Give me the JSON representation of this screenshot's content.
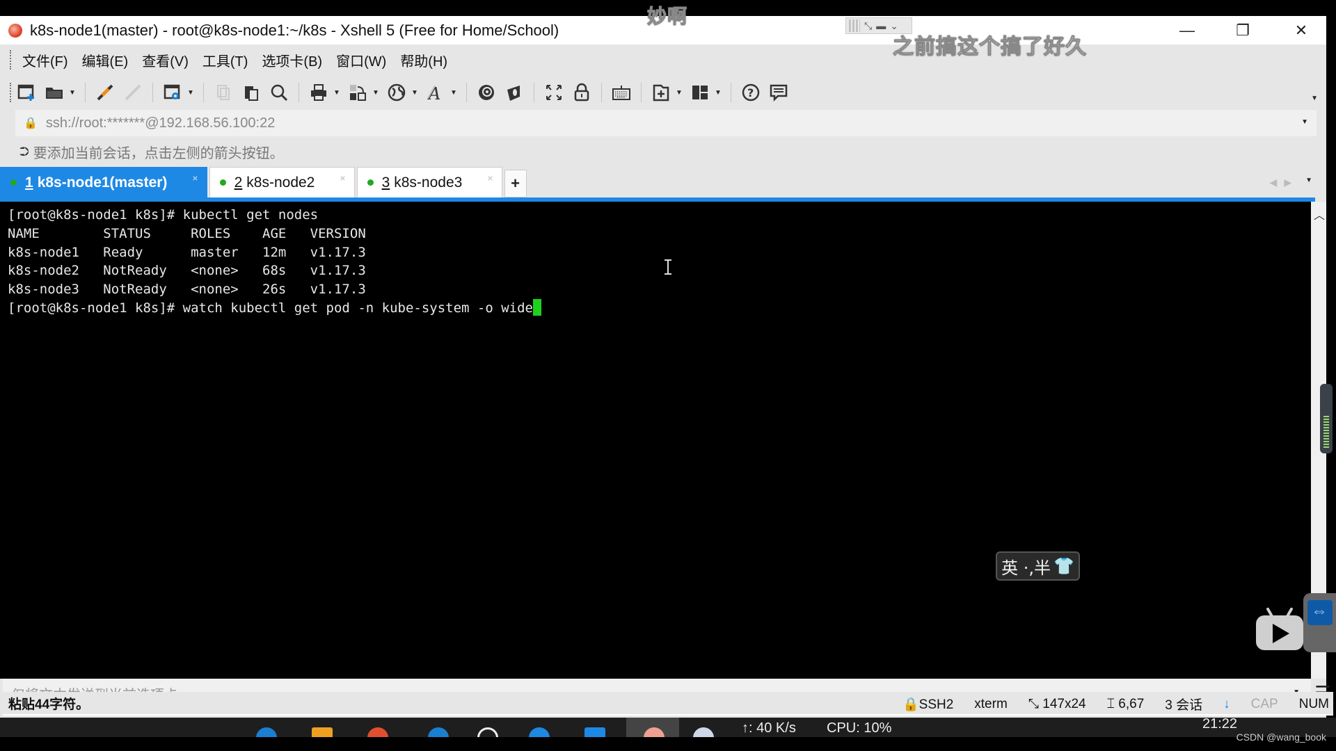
{
  "overlay": {
    "subtitle_top": "妙啊",
    "subtitle_right": "之前搞这个搞了好久"
  },
  "window": {
    "title": "k8s-node1(master) - root@k8s-node1:~/k8s - Xshell 5 (Free for Home/School)",
    "controls": {
      "minimize": "—",
      "maximize": "❐",
      "close": "✕"
    }
  },
  "menu": {
    "items": [
      {
        "label": "文件(F)"
      },
      {
        "label": "编辑(E)"
      },
      {
        "label": "查看(V)"
      },
      {
        "label": "工具(T)"
      },
      {
        "label": "选项卡(B)"
      },
      {
        "label": "窗口(W)"
      },
      {
        "label": "帮助(H)"
      }
    ]
  },
  "toolbar": {
    "buttons": [
      {
        "name": "new-session",
        "icon": "new-session-icon",
        "dropdown": false
      },
      {
        "name": "open",
        "icon": "folder-open-icon",
        "dropdown": true
      },
      {
        "name": "connect",
        "icon": "connect-icon",
        "dropdown": false
      },
      {
        "name": "disconnect",
        "icon": "disconnect-icon",
        "dropdown": false,
        "disabled": true
      },
      {
        "name": "properties",
        "icon": "properties-gear-icon",
        "dropdown": true
      },
      {
        "name": "copy",
        "icon": "copy-icon",
        "dropdown": false,
        "disabled": true
      },
      {
        "name": "paste",
        "icon": "paste-icon",
        "dropdown": false
      },
      {
        "name": "find",
        "icon": "search-icon",
        "dropdown": false
      },
      {
        "name": "print",
        "icon": "print-icon",
        "dropdown": true
      },
      {
        "name": "transfer",
        "icon": "transfer-icon",
        "dropdown": true
      },
      {
        "name": "encoding",
        "icon": "globe-icon",
        "dropdown": true
      },
      {
        "name": "font",
        "icon": "font-icon",
        "dropdown": true
      },
      {
        "name": "xftp",
        "icon": "xftp-icon",
        "dropdown": false
      },
      {
        "name": "xmanager",
        "icon": "xmanager-icon",
        "dropdown": false
      },
      {
        "name": "fullscreen",
        "icon": "fullscreen-icon",
        "dropdown": false
      },
      {
        "name": "lock",
        "icon": "lock-icon",
        "dropdown": false
      },
      {
        "name": "keyboard",
        "icon": "keyboard-icon",
        "dropdown": false
      },
      {
        "name": "new-tab",
        "icon": "add-tab-icon",
        "dropdown": true
      },
      {
        "name": "layout",
        "icon": "layout-icon",
        "dropdown": true
      },
      {
        "name": "help",
        "icon": "help-icon",
        "dropdown": false
      },
      {
        "name": "chat",
        "icon": "chat-icon",
        "dropdown": false
      }
    ]
  },
  "address": {
    "value": "ssh://root:*******@192.168.56.100:22"
  },
  "hint": {
    "text": "要添加当前会话，点击左侧的箭头按钮。"
  },
  "tabs": [
    {
      "num": "1",
      "label": "k8s-node1(master)",
      "active": true,
      "status": "connected"
    },
    {
      "num": "2",
      "label": "k8s-node2",
      "active": false,
      "status": "connected"
    },
    {
      "num": "3",
      "label": "k8s-node3",
      "active": false,
      "status": "connected"
    }
  ],
  "tab_add_label": "+",
  "terminal": {
    "lines": [
      "[root@k8s-node1 k8s]# kubectl get nodes",
      "NAME        STATUS     ROLES    AGE   VERSION",
      "k8s-node1   Ready      master   12m   v1.17.3",
      "k8s-node2   NotReady   <none>   68s   v1.17.3",
      "k8s-node3   NotReady   <none>   26s   v1.17.3"
    ],
    "current_prompt": "[root@k8s-node1 k8s]# watch kubectl get pod -n kube-system -o wide"
  },
  "ime": {
    "label": "英 ·,半",
    "skin_icon": "👕"
  },
  "send_bar": {
    "placeholder": "仅将文本发送到当前选项卡"
  },
  "status": {
    "message": "粘贴44字符。",
    "protocol": "SSH2",
    "term_type": "xterm",
    "size": "147x24",
    "cursor_pos": "6,67",
    "sessions": "3 会话",
    "cap": "CAP",
    "num": "NUM"
  },
  "taskbar": {
    "net_speed": "↑: 40 K/s",
    "cpu": "CPU: 10%",
    "time": "21:22"
  },
  "watermark": "CSDN @wang_book"
}
